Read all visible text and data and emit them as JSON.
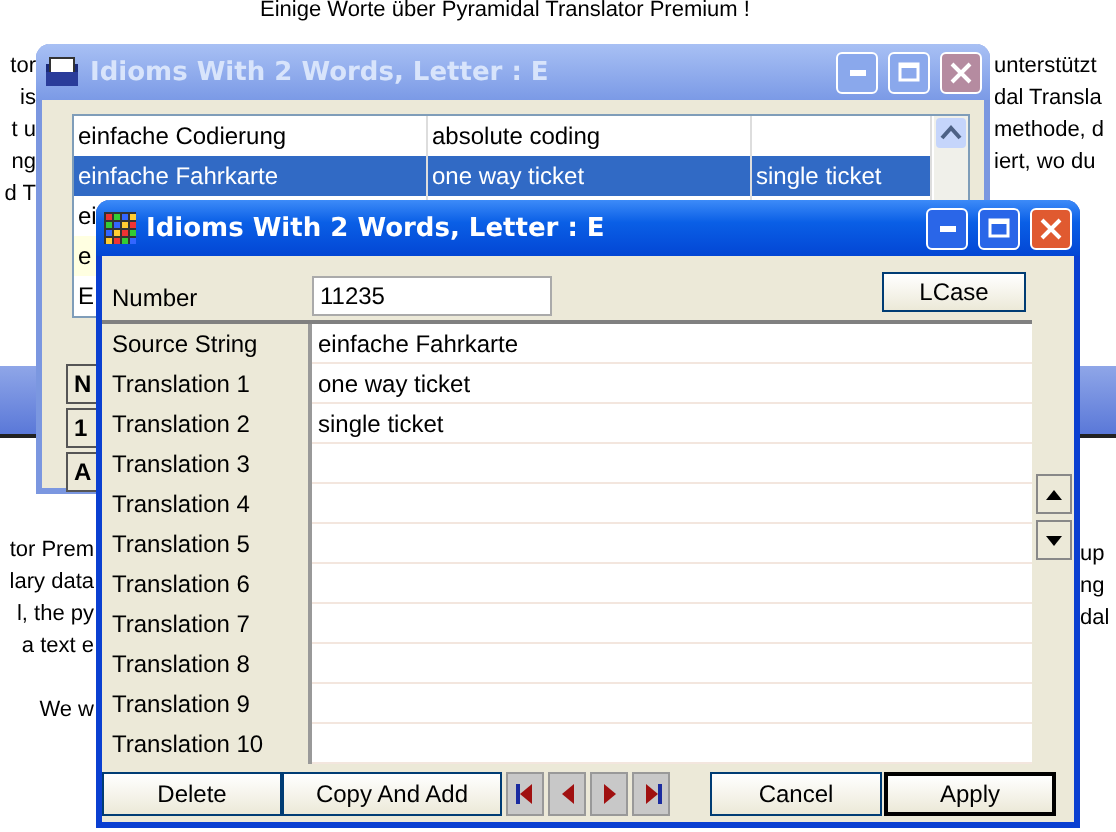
{
  "document": {
    "heading": "Einige Worte über Pyramidal Translator Premium !",
    "upper_left": [
      "tor",
      "is",
      "t u",
      "ng",
      "d T"
    ],
    "upper_right": [
      "unterstützt",
      "dal Transla",
      "methode, d",
      "iert, wo du"
    ],
    "lower_left": [
      "tor Prem",
      "lary data",
      "l, the py",
      "a text e"
    ],
    "lower_left_2": "We w",
    "lower_right": [
      "up",
      "ng",
      "dal"
    ]
  },
  "back_window": {
    "title": "Idioms With 2 Words, Letter : E",
    "active": false,
    "rows": [
      {
        "cells": [
          "einfache Codierung",
          "absolute coding"
        ],
        "selected": false,
        "highlighted": false
      },
      {
        "cells": [
          "einfache Fahrkarte",
          "one way ticket",
          "single ticket"
        ],
        "selected": true,
        "highlighted": false
      },
      {
        "cells": [
          "ei"
        ],
        "selected": false,
        "highlighted": false
      },
      {
        "cells": [
          "e"
        ],
        "selected": false,
        "highlighted": true
      },
      {
        "cells": [
          "E"
        ],
        "selected": false,
        "highlighted": false
      }
    ],
    "buttons": [
      "N",
      "1",
      "A"
    ]
  },
  "front_window": {
    "title": "Idioms With 2 Words, Letter : E",
    "active": true,
    "number_label": "Number",
    "number": "11235",
    "lcase_button": "LCase",
    "fields": [
      {
        "label": "Source String",
        "value": "einfache Fahrkarte"
      },
      {
        "label": "Translation 1",
        "value": "one way ticket"
      },
      {
        "label": "Translation 2",
        "value": "single ticket"
      },
      {
        "label": "Translation 3"
      },
      {
        "label": "Translation 4"
      },
      {
        "label": "Translation 5"
      },
      {
        "label": "Translation 6"
      },
      {
        "label": "Translation 7"
      },
      {
        "label": "Translation 8"
      },
      {
        "label": "Translation 9"
      },
      {
        "label": "Translation 10"
      }
    ],
    "left_buttons": [
      {
        "label": "Delete",
        "default": false
      },
      {
        "label": "Copy And Add",
        "default": false
      }
    ],
    "right_buttons": [
      {
        "label": "Cancel",
        "default": false
      },
      {
        "label": "Apply",
        "default": true
      }
    ]
  }
}
